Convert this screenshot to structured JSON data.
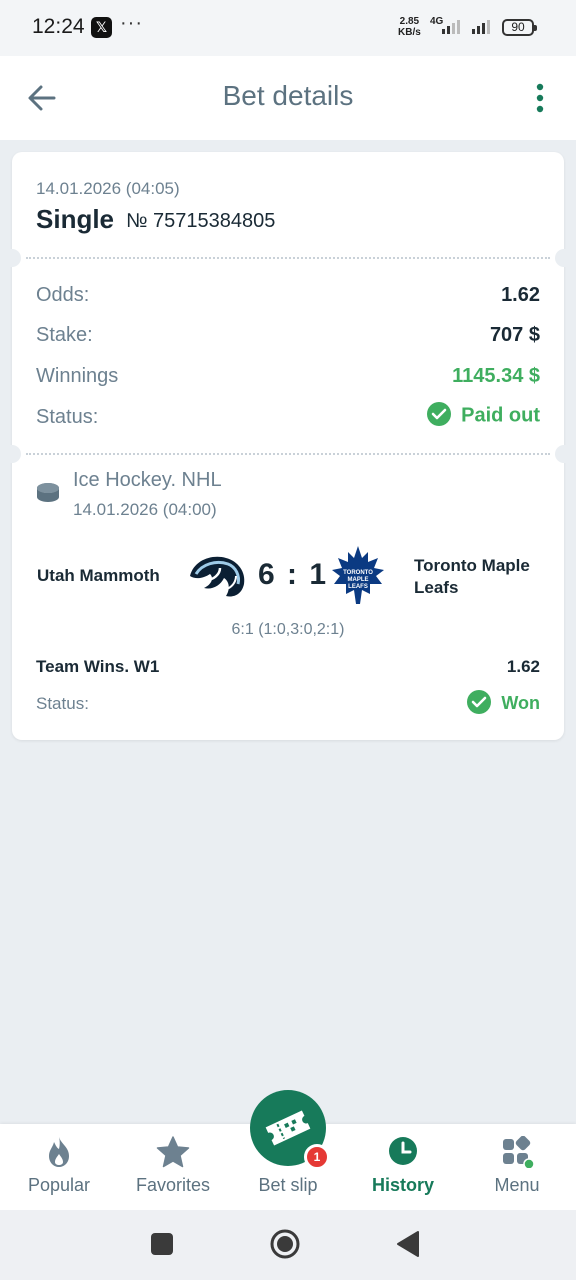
{
  "status_bar": {
    "time": "12:24",
    "x_app": "𝕏",
    "dots": "···",
    "speed_value": "2.85",
    "speed_unit": "KB/s",
    "network": "4G",
    "battery": "90"
  },
  "header": {
    "title": "Bet details",
    "back_icon": "arrow-left-icon",
    "more_icon": "more-vertical-icon"
  },
  "bet": {
    "date": "14.01.2026 (04:05)",
    "type": "Single",
    "number": "№ 75715384805",
    "odds_label": "Odds:",
    "odds_value": "1.62",
    "stake_label": "Stake:",
    "stake_value": "707 $",
    "winnings_label": "Winnings",
    "winnings_value": "1145.34 $",
    "status_label": "Status:",
    "status_value": "Paid out"
  },
  "event": {
    "sport_icon": "hockey-puck-icon",
    "league": "Ice Hockey. NHL",
    "date": "14.01.2026 (04:00)",
    "team1": "Utah Mammoth",
    "score": "6 : 1",
    "team2": "Toronto Maple Leafs",
    "periods": "6:1 (1:0,3:0,2:1)",
    "market": "Team Wins. W1",
    "market_odds": "1.62",
    "status_label": "Status:",
    "status_value": "Won"
  },
  "bottom_nav": {
    "items": [
      {
        "label": "Popular",
        "icon": "flame-icon"
      },
      {
        "label": "Favorites",
        "icon": "star-icon"
      },
      {
        "label": "Bet slip",
        "icon": "ticket-icon",
        "badge": "1"
      },
      {
        "label": "History",
        "icon": "clock-icon",
        "active": true
      },
      {
        "label": "Menu",
        "icon": "grid-icon"
      }
    ]
  },
  "colors": {
    "accent": "#177a5a",
    "success": "#3fae5f",
    "muted": "#6d8190",
    "background": "#eaeef2"
  }
}
